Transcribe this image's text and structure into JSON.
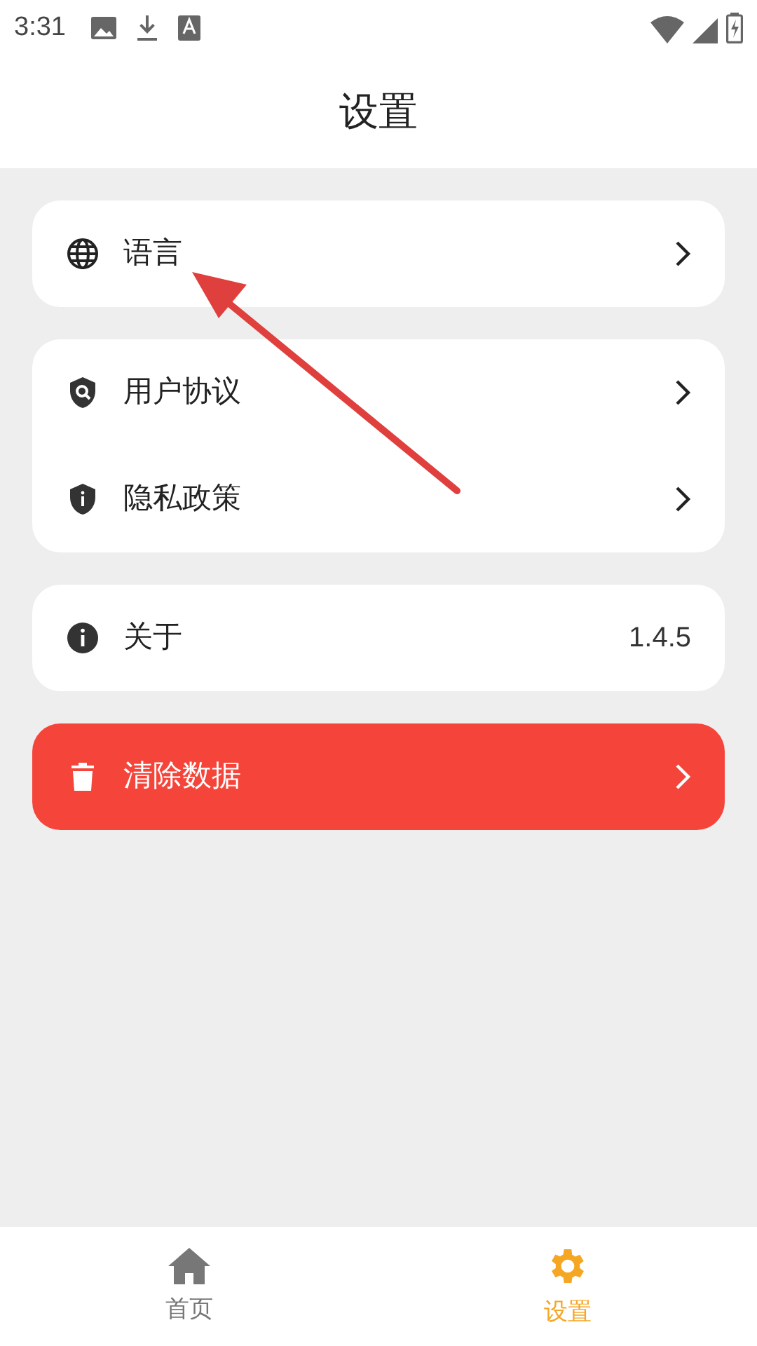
{
  "status_bar": {
    "time": "3:31"
  },
  "header": {
    "title": "设置"
  },
  "groups": [
    {
      "items": [
        {
          "kind": "globe",
          "label": "语言",
          "chevron": true
        }
      ]
    },
    {
      "items": [
        {
          "kind": "agreement",
          "label": "用户协议",
          "chevron": true
        },
        {
          "kind": "privacy",
          "label": "隐私政策",
          "chevron": true
        }
      ]
    },
    {
      "items": [
        {
          "kind": "info",
          "label": "关于",
          "value": "1.4.5",
          "chevron": false
        }
      ]
    },
    {
      "kind": "danger",
      "items": [
        {
          "kind": "trash",
          "label": "清除数据",
          "chevron": true
        }
      ]
    }
  ],
  "bottom_nav": [
    {
      "kind": "home",
      "label": "首页",
      "selected": false
    },
    {
      "kind": "settings",
      "label": "设置",
      "selected": true
    }
  ]
}
